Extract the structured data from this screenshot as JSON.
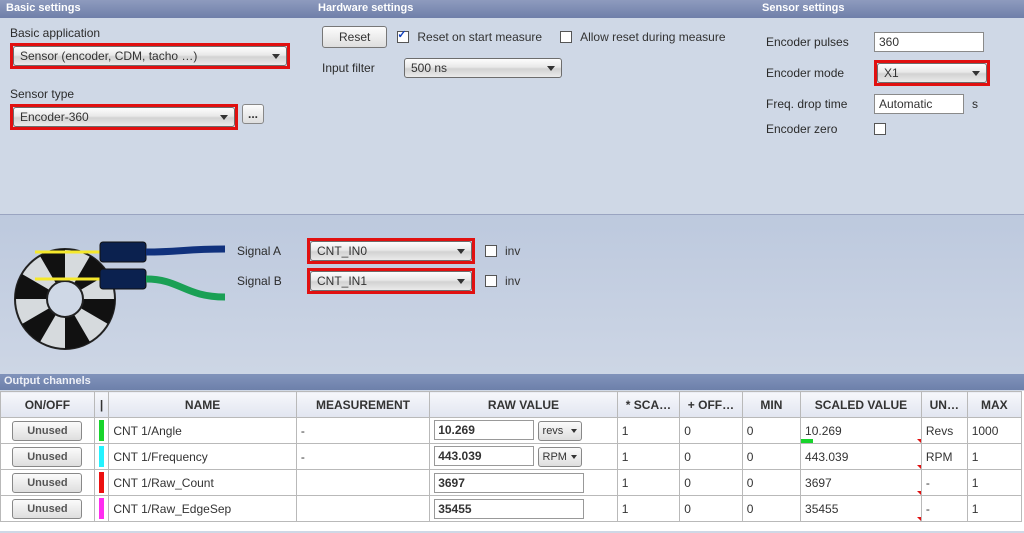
{
  "headers": {
    "basic": "Basic settings",
    "hardware": "Hardware settings",
    "sensor": "Sensor settings",
    "output": "Output channels"
  },
  "basic": {
    "app_label": "Basic application",
    "app_value": "Sensor (encoder, CDM, tacho …)",
    "type_label": "Sensor type",
    "type_value": "Encoder-360",
    "dots": "..."
  },
  "hardware": {
    "reset_btn": "Reset",
    "reset_start": "Reset on start measure",
    "allow_reset": "Allow reset during measure",
    "filter_label": "Input filter",
    "filter_value": "500 ns"
  },
  "sensor": {
    "pulses_label": "Encoder pulses",
    "pulses_value": "360",
    "mode_label": "Encoder mode",
    "mode_value": "X1",
    "freq_label": "Freq. drop time",
    "freq_value": "Automatic",
    "freq_unit": "s",
    "zero_label": "Encoder zero"
  },
  "signals": {
    "a_label": "Signal A",
    "a_value": "CNT_IN0",
    "b_label": "Signal B",
    "b_value": "CNT_IN1",
    "inv": "inv"
  },
  "grid": {
    "cols": {
      "onoff": "ON/OFF",
      "color": "|",
      "name": "NAME",
      "meas": "MEASUREMENT",
      "raw": "RAW VALUE",
      "sca": "* SCA…",
      "off": "+ OFF…",
      "min": "MIN",
      "scaled": "SCALED VALUE",
      "unit": "UN…",
      "max": "MAX"
    },
    "unused": "Unused",
    "rows": [
      {
        "color": "#18d42c",
        "name": "CNT 1/Angle",
        "meas": "-",
        "raw": "10.269",
        "raw_u": "revs",
        "sca": "1",
        "off": "0",
        "min": "0",
        "scaled": "10.269",
        "bar": "#18d42c",
        "barw": "10%",
        "unit": "Revs",
        "max": "1000"
      },
      {
        "color": "#24f3ff",
        "name": "CNT 1/Frequency",
        "meas": "-",
        "raw": "443.039",
        "raw_u": "RPM",
        "sca": "1",
        "off": "0",
        "min": "0",
        "scaled": "443.039",
        "bar": "",
        "barw": "",
        "unit": "RPM",
        "max": "1"
      },
      {
        "color": "#ec1010",
        "name": "CNT 1/Raw_Count",
        "meas": "",
        "raw": "3697",
        "raw_u": "",
        "sca": "1",
        "off": "0",
        "min": "0",
        "scaled": "3697",
        "bar": "",
        "barw": "",
        "unit": "-",
        "max": "1"
      },
      {
        "color": "#ff2df0",
        "name": "CNT 1/Raw_EdgeSep",
        "meas": "",
        "raw": "35455",
        "raw_u": "",
        "sca": "1",
        "off": "0",
        "min": "0",
        "scaled": "35455",
        "bar": "",
        "barw": "",
        "unit": "-",
        "max": "1"
      }
    ]
  }
}
